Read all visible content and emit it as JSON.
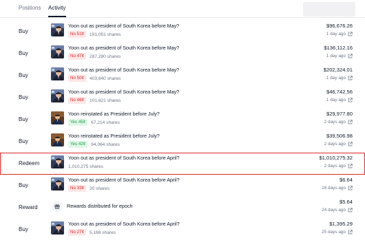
{
  "tabs": {
    "positions": "Positions",
    "activity": "Activity"
  },
  "rows": [
    {
      "type": "Buy",
      "market": "Yoon out as president of South Korea before May?",
      "outcome": "No",
      "price": "51¢",
      "shares": "191,051 shares",
      "amount": "$96,676.26",
      "time": "1 day ago",
      "image": "yoon"
    },
    {
      "type": "Buy",
      "market": "Yoon out as president of South Korea before May?",
      "outcome": "No",
      "price": "47¢",
      "shares": "287,280 shares",
      "amount": "$136,112.16",
      "time": "1 day ago",
      "image": "yoon"
    },
    {
      "type": "Buy",
      "market": "Yoon out as president of South Korea before May?",
      "outcome": "No",
      "price": "50¢",
      "shares": "403,640 shares",
      "amount": "$202,324.01",
      "time": "1 day ago",
      "image": "yoon"
    },
    {
      "type": "Buy",
      "market": "Yoon out as president of South Korea before May?",
      "outcome": "No",
      "price": "46¢",
      "shares": "101,621 shares",
      "amount": "$46,742.56",
      "time": "1 day ago",
      "image": "yoon"
    },
    {
      "type": "Buy",
      "market": "Yoon reinstated as President before July?",
      "outcome": "Yes",
      "price": "45¢",
      "shares": "67,214 shares",
      "amount": "$29,977.80",
      "time": "2 days ago",
      "image": "reinstated"
    },
    {
      "type": "Buy",
      "market": "Yoon reinstated as President before July?",
      "outcome": "Yes",
      "price": "42¢",
      "shares": "94,064 shares",
      "amount": "$39,506.98",
      "time": "2 days ago",
      "image": "reinstated"
    },
    {
      "type": "Redeem",
      "market": "Yoon out as president of South Korea before April?",
      "outcome": "",
      "price": "",
      "shares": "1,010,275 shares",
      "amount": "$1,010,275.32",
      "time": "2 days ago",
      "image": "yoon",
      "highlighted": true
    },
    {
      "type": "Buy",
      "market": "Yoon out as president of South Korea before April?",
      "outcome": "No",
      "price": "33¢",
      "shares": "20 shares",
      "amount": "$6.64",
      "time": "16 days ago",
      "image": "yoon"
    },
    {
      "type": "Reward",
      "market": "Rewards distributed for epoch",
      "outcome": "",
      "price": "",
      "shares": "",
      "amount": "$5.64",
      "time": "24 days ago",
      "image": "gift"
    },
    {
      "type": "Buy",
      "market": "Yoon out as president of South Korea before April?",
      "outcome": "No",
      "price": "27¢",
      "shares": "5,168 shares",
      "amount": "$1,395.29",
      "time": "25 days ago",
      "image": "yoon"
    }
  ],
  "colors": {
    "no_bg": "#fde7e7",
    "no_text": "#dc2626",
    "yes_bg": "#e0f5e6",
    "yes_text": "#16a34a",
    "highlight_border": "#dc2626"
  },
  "icons": {
    "external": "external-link-icon",
    "gift": "gift-icon"
  }
}
